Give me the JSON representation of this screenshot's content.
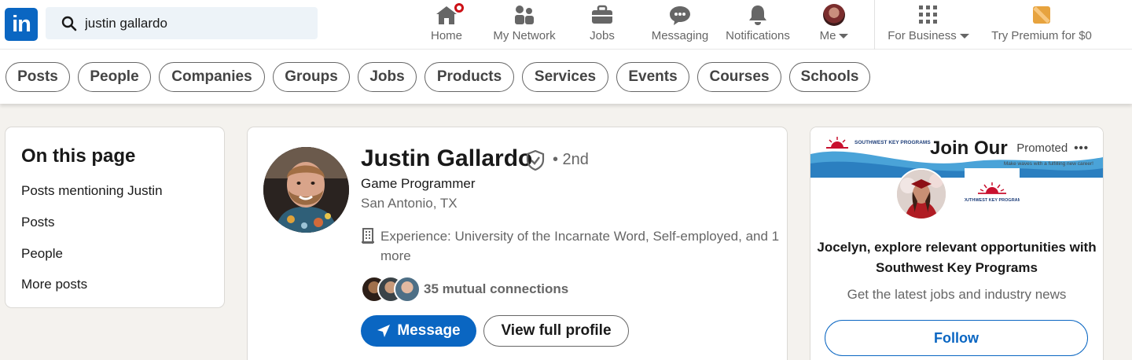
{
  "nav": {
    "logo_text": "in",
    "search_value": "justin gallardo",
    "items": [
      {
        "label": "Home",
        "icon": "home-icon"
      },
      {
        "label": "My Network",
        "icon": "network-icon"
      },
      {
        "label": "Jobs",
        "icon": "briefcase-icon"
      },
      {
        "label": "Messaging",
        "icon": "messaging-icon"
      },
      {
        "label": "Notifications",
        "icon": "bell-icon"
      },
      {
        "label": "Me",
        "icon": "avatar"
      },
      {
        "label": "For Business",
        "icon": "grid-icon"
      },
      {
        "label": "Try Premium for $0",
        "icon": "premium-icon"
      }
    ]
  },
  "filters": [
    "Posts",
    "People",
    "Companies",
    "Groups",
    "Jobs",
    "Products",
    "Services",
    "Events",
    "Courses",
    "Schools"
  ],
  "on_this_page": {
    "title": "On this page",
    "links": [
      "Posts mentioning Justin",
      "Posts",
      "People",
      "More posts"
    ]
  },
  "profile": {
    "name": "Justin Gallardo",
    "degree": "• 2nd",
    "headline": "Game Programmer",
    "location": "San Antonio, TX",
    "experience": "Experience: University of the Incarnate Word, Self-employed, and 1 more",
    "mutual": "35 mutual connections",
    "message_label": "Message",
    "view_label": "View full profile"
  },
  "ad": {
    "banner_brand": "SOUTHWEST KEY PROGRAMS",
    "banner_title": "Join Our",
    "banner_tagline": "Make waves with a fulfilling new career!",
    "promoted_label": "Promoted",
    "headline": "Jocelyn, explore relevant opportunities with Southwest Key Programs",
    "subtext": "Get the latest jobs and industry news",
    "follow_label": "Follow"
  },
  "colors": {
    "brand": "#0a66c2",
    "notification": "#cc1016",
    "background": "#f4f2ee"
  }
}
